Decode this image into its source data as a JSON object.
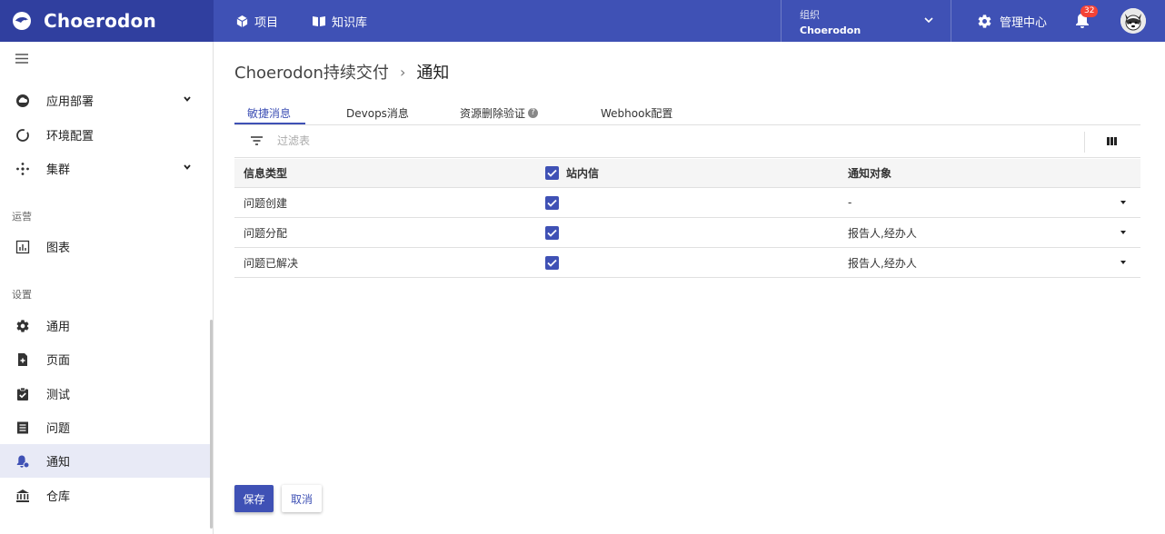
{
  "app": {
    "name": "Choerodon"
  },
  "topbar": {
    "nav": [
      {
        "label": "项目"
      },
      {
        "label": "知识库"
      }
    ],
    "org": {
      "label": "组织",
      "name": "Choerodon"
    },
    "admin_label": "管理中心",
    "notification_count": "32"
  },
  "sidebar": {
    "items_top": [
      {
        "label": "应用部署",
        "icon": "cloud-icon",
        "expandable": true
      },
      {
        "label": "环境配置",
        "icon": "ring-icon",
        "expandable": false
      },
      {
        "label": "集群",
        "icon": "cluster-icon",
        "expandable": true
      }
    ],
    "section_ops": "运营",
    "ops_items": [
      {
        "label": "图表",
        "icon": "chart-icon"
      }
    ],
    "section_settings": "设置",
    "settings_items": [
      {
        "label": "通用",
        "icon": "gear-icon"
      },
      {
        "label": "页面",
        "icon": "page-add-icon"
      },
      {
        "label": "测试",
        "icon": "clipboard-check-icon"
      },
      {
        "label": "问题",
        "icon": "list-icon"
      },
      {
        "label": "通知",
        "icon": "bell-settings-icon",
        "active": true
      },
      {
        "label": "仓库",
        "icon": "bank-icon"
      }
    ]
  },
  "breadcrumb": {
    "parent": "Choerodon持续交付",
    "separator": "›",
    "current": "通知"
  },
  "tabs": [
    {
      "label": "敏捷消息",
      "active": true
    },
    {
      "label": "Devops消息"
    },
    {
      "label": "资源删除验证",
      "help": "?"
    },
    {
      "label": "Webhook配置"
    }
  ],
  "filter": {
    "placeholder": "过滤表"
  },
  "table": {
    "headers": [
      "信息类型",
      "站内信",
      "通知对象"
    ],
    "rows": [
      {
        "type": "问题创建",
        "in_app": true,
        "target": "-"
      },
      {
        "type": "问题分配",
        "in_app": true,
        "target": "报告人,经办人"
      },
      {
        "type": "问题已解决",
        "in_app": true,
        "target": "报告人,经办人"
      }
    ]
  },
  "buttons": {
    "save": "保存",
    "cancel": "取消"
  },
  "colors": {
    "primary": "#3f51b5",
    "primary_dark": "#303f9f",
    "badge": "#f44336",
    "active_bg": "#e8eaf6"
  }
}
